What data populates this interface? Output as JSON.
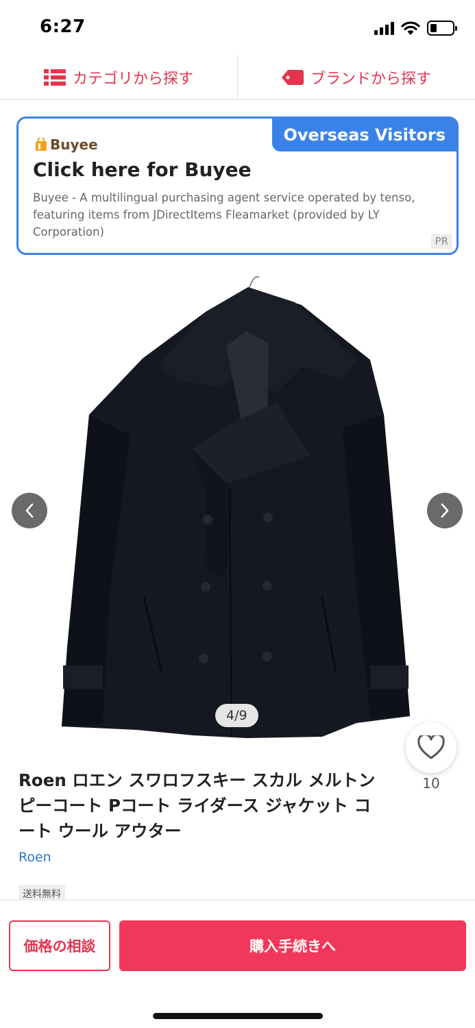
{
  "status_bar": {
    "time": "6:27",
    "battery_level": 0.3
  },
  "nav": {
    "category_label": "カテゴリから探す",
    "brand_label": "ブランドから探す",
    "accent_color": "#e5344f"
  },
  "banner": {
    "tag": "Overseas Visitors",
    "logo": "Buyee",
    "title": "Click here for Buyee",
    "description": "Buyee - A multilingual purchasing agent service operated by tenso, featuring items from JDirectItems Fleamarket (provided by LY Corporation)",
    "pr_badge": "PR",
    "accent_color": "#3b82e8"
  },
  "gallery": {
    "counter": "4/9",
    "current": 4,
    "total": 9
  },
  "product": {
    "title": "Roen ロエン スワロフスキー スカル メルトン ピーコート Pコート ライダース ジャケット コート ウール アウター",
    "brand": "Roen",
    "shipping_badge": "送料無料",
    "like_count": "10"
  },
  "actions": {
    "negotiate_label": "価格の相談",
    "purchase_label": "購入手続きへ",
    "purchase_color": "#f2385a"
  },
  "icons": [
    "list-icon",
    "tag-icon",
    "wifi-icon",
    "signal-icon",
    "battery-icon",
    "chevron-left-icon",
    "chevron-right-icon",
    "heart-icon",
    "buyee-logo-icon"
  ]
}
